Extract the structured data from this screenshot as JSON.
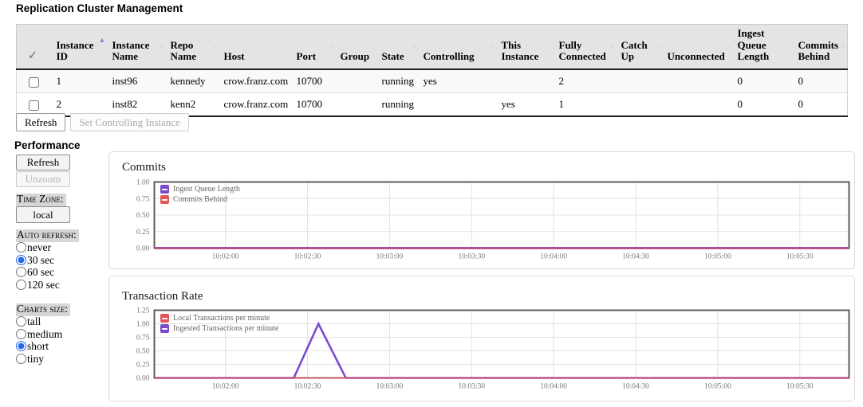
{
  "page": {
    "title": "Replication Cluster Management"
  },
  "cluster_table": {
    "header": {
      "select_all_icon": "✓",
      "columns": [
        "Instance ID",
        "Instance Name",
        "Repo Name",
        "Host",
        "Port",
        "Group",
        "State",
        "Controlling",
        "This Instance",
        "Fully Connected",
        "Catch Up",
        "Unconnected",
        "Ingest Queue Length",
        "Commits Behind"
      ],
      "sorted_column": "Instance ID",
      "sort_direction": "asc"
    },
    "rows": [
      {
        "checked": false,
        "cells": [
          "1",
          "inst96",
          "kennedy",
          "crow.franz.com",
          "10700",
          "",
          "running",
          "yes",
          "",
          "2",
          "",
          "",
          "0",
          "0"
        ]
      },
      {
        "checked": false,
        "cells": [
          "2",
          "inst82",
          "kenn2",
          "crow.franz.com",
          "10700",
          "",
          "running",
          "",
          "yes",
          "1",
          "",
          "",
          "0",
          "0"
        ]
      }
    ],
    "actions": {
      "refresh": "Refresh",
      "set_controlling": "Set Controlling Instance"
    }
  },
  "performance": {
    "title": "Performance",
    "refresh_label": "Refresh",
    "unzoom_label": "Unzoom",
    "time_zone": {
      "label": "Time Zone:",
      "value": "local"
    },
    "auto_refresh": {
      "label": "Auto refresh:",
      "options": [
        {
          "label": "never",
          "selected": false
        },
        {
          "label": "30 sec",
          "selected": true
        },
        {
          "label": "60 sec",
          "selected": false
        },
        {
          "label": "120 sec",
          "selected": false
        }
      ]
    },
    "charts_size": {
      "label": "Charts size:",
      "options": [
        {
          "label": "tall",
          "selected": false
        },
        {
          "label": "medium",
          "selected": false
        },
        {
          "label": "short",
          "selected": true
        },
        {
          "label": "tiny",
          "selected": false
        }
      ]
    }
  },
  "chart_data": [
    {
      "type": "line",
      "title": "Commits",
      "xlim": [
        "10:01:34",
        "10:05:48"
      ],
      "x_ticks": [
        "10:02:00",
        "10:02:30",
        "10:03:00",
        "10:03:30",
        "10:04:00",
        "10:04:30",
        "10:05:00",
        "10:05:30"
      ],
      "ylim": [
        0,
        1.0
      ],
      "y_ticks": [
        "0.00",
        "0.25",
        "0.50",
        "0.75",
        "1.00"
      ],
      "grid": true,
      "legend_position": "top-left",
      "series": [
        {
          "name": "Ingest Queue Length",
          "color": "#7a4ccc",
          "stroke_width": 3,
          "z": 1,
          "points": [
            [
              "10:01:34",
              0
            ],
            [
              "10:05:48",
              0
            ]
          ]
        },
        {
          "name": "Commits Behind",
          "color": "#e25656",
          "stroke_width": 1.6,
          "z": 2,
          "points": [
            [
              "10:01:34",
              0
            ],
            [
              "10:05:48",
              0
            ]
          ]
        }
      ]
    },
    {
      "type": "line",
      "title": "Transaction Rate",
      "xlim": [
        "10:01:34",
        "10:05:48"
      ],
      "x_ticks": [
        "10:02:00",
        "10:02:30",
        "10:03:00",
        "10:03:30",
        "10:04:00",
        "10:04:30",
        "10:05:00",
        "10:05:30"
      ],
      "ylim": [
        0,
        1.25
      ],
      "y_ticks": [
        "0.00",
        "0.25",
        "0.50",
        "0.75",
        "1.00",
        "1.25"
      ],
      "grid": true,
      "legend_position": "top-left",
      "series": [
        {
          "name": "Local Transactions per minute",
          "color": "#e25656",
          "stroke_width": 1.6,
          "z": 2,
          "points": [
            [
              "10:01:34",
              0
            ],
            [
              "10:05:48",
              0
            ]
          ]
        },
        {
          "name": "Ingested Transactions per minute",
          "color": "#7a4ccc",
          "stroke_width": 2.6,
          "z": 1,
          "points": [
            [
              "10:01:34",
              0
            ],
            [
              "10:02:25",
              0
            ],
            [
              "10:02:34",
              1
            ],
            [
              "10:02:44",
              0
            ],
            [
              "10:05:48",
              0
            ]
          ]
        }
      ]
    }
  ]
}
